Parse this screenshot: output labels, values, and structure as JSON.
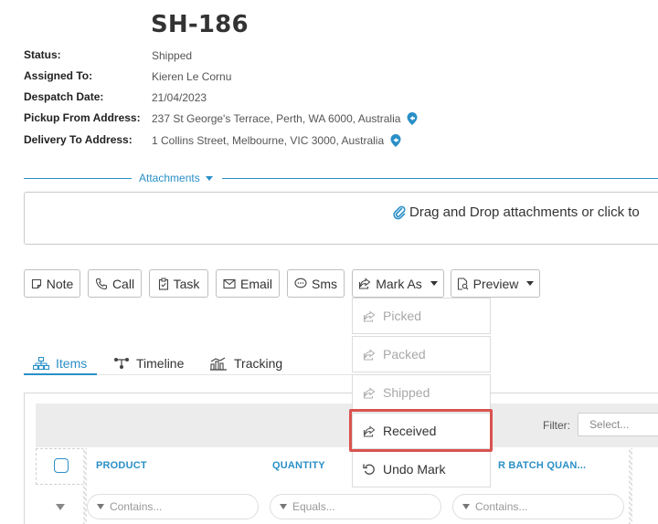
{
  "shipment": {
    "id": "SH-186",
    "fields": [
      {
        "label": "Status:",
        "value": "Shipped"
      },
      {
        "label": "Assigned To:",
        "value": "Kieren Le Cornu"
      },
      {
        "label": "Despatch Date:",
        "value": "21/04/2023"
      },
      {
        "label": "Pickup From Address:",
        "value": "237 St George's Terrace, Perth, WA 6000, Australia",
        "icon": "map-pin-icon"
      },
      {
        "label": "Delivery To Address:",
        "value": "1 Collins Street, Melbourne, VIC 3000, Australia",
        "icon": "map-pin-icon"
      }
    ]
  },
  "attachments": {
    "toggle_label": "Attachments",
    "dropzone_text": "Drag and Drop attachments or click to"
  },
  "actions": {
    "note": "Note",
    "call": "Call",
    "task": "Task",
    "email": "Email",
    "sms": "Sms",
    "mark_as": "Mark As",
    "preview": "Preview"
  },
  "mark_as_menu": [
    {
      "label": "Picked",
      "enabled": false,
      "icon": "share-icon"
    },
    {
      "label": "Packed",
      "enabled": false,
      "icon": "share-icon"
    },
    {
      "label": "Shipped",
      "enabled": false,
      "icon": "share-icon"
    },
    {
      "label": "Received",
      "enabled": true,
      "highlighted": true,
      "icon": "share-icon"
    },
    {
      "label": "Undo Mark",
      "enabled": true,
      "icon": "undo-icon"
    }
  ],
  "tabs": [
    {
      "label": "Items",
      "active": true,
      "icon": "hierarchy-icon"
    },
    {
      "label": "Timeline",
      "active": false,
      "icon": "timeline-icon"
    },
    {
      "label": "Tracking",
      "active": false,
      "icon": "tracking-icon"
    }
  ],
  "grid": {
    "filter_label": "Filter:",
    "filter_placeholder": "Select...",
    "columns": [
      "PRODUCT",
      "QUANTITY",
      "R BATCH QUAN..."
    ],
    "column_filters": [
      "Contains...",
      "Equals...",
      "Contains..."
    ]
  },
  "colors": {
    "accent": "#2a8fc7",
    "highlight": "#d9534f",
    "disabled_text": "#a8a8a8"
  }
}
